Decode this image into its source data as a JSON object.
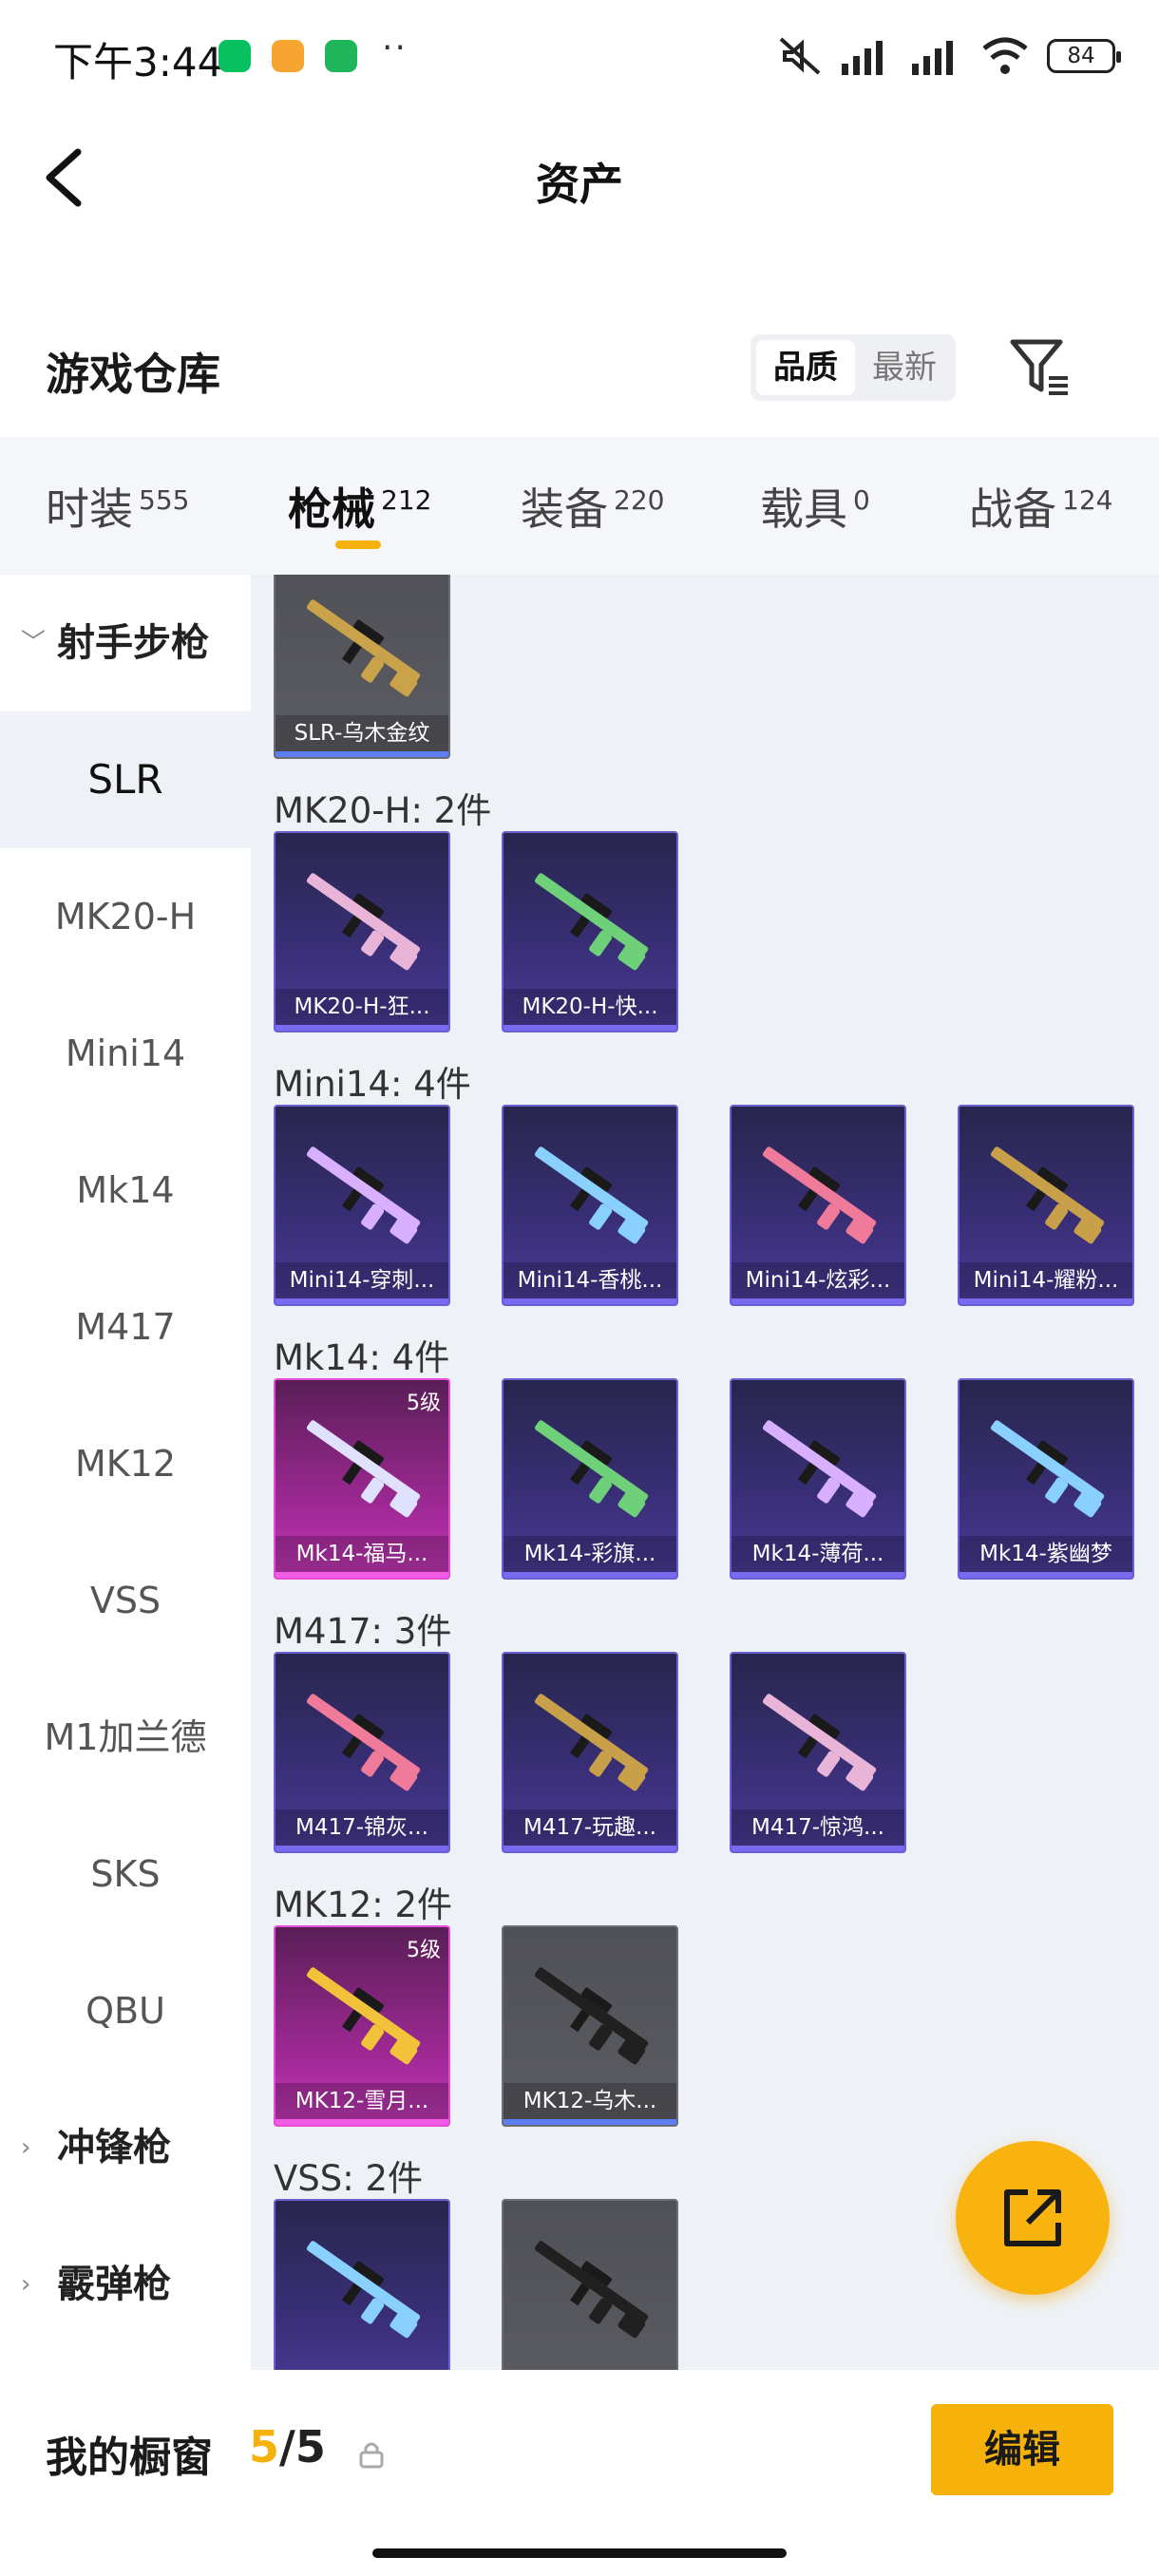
{
  "status_bar": {
    "time": "下午3:44",
    "more": "··",
    "battery": "84"
  },
  "nav": {
    "title": "资产"
  },
  "section": {
    "title": "游戏仓库",
    "sort_options": [
      "品质",
      "最新"
    ]
  },
  "tabs": [
    {
      "label": "时装",
      "count": "555"
    },
    {
      "label": "枪械",
      "count": "212"
    },
    {
      "label": "装备",
      "count": "220"
    },
    {
      "label": "载具",
      "count": "0"
    },
    {
      "label": "战备",
      "count": "124"
    }
  ],
  "sidebar": {
    "groups": [
      "射手步枪",
      "冲锋枪",
      "霰弹枪"
    ],
    "items": [
      "SLR",
      "MK20-H",
      "Mini14",
      "Mk14",
      "M417",
      "MK12",
      "VSS",
      "M1加兰德",
      "SKS",
      "QBU"
    ]
  },
  "content": {
    "groups": [
      {
        "title": "",
        "cards": [
          {
            "name": "SLR-乌木金纹",
            "rarity": "gray"
          }
        ]
      },
      {
        "title": "MK20-H: 2件",
        "cards": [
          {
            "name": "MK20-H-狂...",
            "rarity": "purple"
          },
          {
            "name": "MK20-H-快...",
            "rarity": "purple"
          }
        ]
      },
      {
        "title": "Mini14: 4件",
        "cards": [
          {
            "name": "Mini14-穿刺...",
            "rarity": "purple"
          },
          {
            "name": "Mini14-香桃...",
            "rarity": "purple"
          },
          {
            "name": "Mini14-炫彩...",
            "rarity": "purple"
          },
          {
            "name": "Mini14-耀粉...",
            "rarity": "purple"
          }
        ]
      },
      {
        "title": "Mk14: 4件",
        "cards": [
          {
            "name": "Mk14-福马...",
            "rarity": "pink",
            "level": "5级"
          },
          {
            "name": "Mk14-彩旗...",
            "rarity": "purple"
          },
          {
            "name": "Mk14-薄荷...",
            "rarity": "purple"
          },
          {
            "name": "Mk14-紫幽梦",
            "rarity": "purple"
          }
        ]
      },
      {
        "title": "M417: 3件",
        "cards": [
          {
            "name": "M417-锦灰...",
            "rarity": "purple"
          },
          {
            "name": "M417-玩趣...",
            "rarity": "purple"
          },
          {
            "name": "M417-惊鸿...",
            "rarity": "purple"
          }
        ]
      },
      {
        "title": "MK12: 2件",
        "cards": [
          {
            "name": "MK12-雪月...",
            "rarity": "pink",
            "level": "5级"
          },
          {
            "name": "MK12-乌木...",
            "rarity": "gray"
          }
        ]
      },
      {
        "title": "VSS: 2件",
        "cards": []
      }
    ]
  },
  "bottom": {
    "label": "我的橱窗",
    "current": "5",
    "separator": "/",
    "total": "5",
    "edit": "编辑"
  },
  "colors": {
    "accent": "#f6b10a",
    "purple": "#6b5fd6",
    "pink": "#e44bd8",
    "gray": "#5b5b62"
  }
}
